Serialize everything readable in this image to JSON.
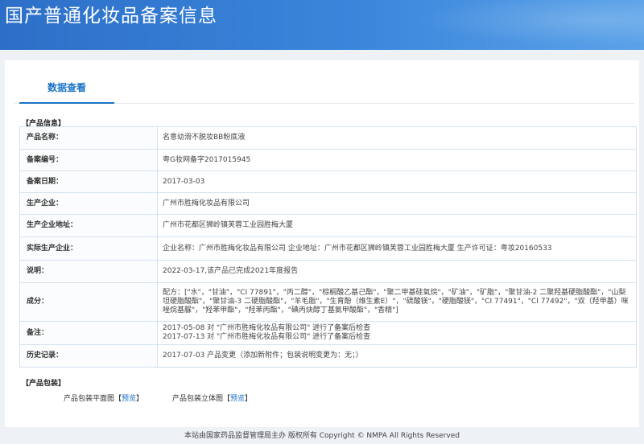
{
  "header": {
    "title": "国产普通化妆品备案信息"
  },
  "tabs": [
    {
      "label": "数据查看"
    }
  ],
  "product_info": {
    "section_title": "【产品信息】",
    "rows": [
      {
        "label": "产品名称：",
        "value": "名意幼滑不脱妆BB粉底液"
      },
      {
        "label": "备案编号：",
        "value": "粤G妆网备字2017015945"
      },
      {
        "label": "备案日期：",
        "value": "2017-03-03"
      },
      {
        "label": "生产企业：",
        "value": "广州市胜梅化妆品有限公司"
      },
      {
        "label": "生产企业地址：",
        "value": "广州市花都区狮岭镇芙蓉工业园胜梅大厦"
      },
      {
        "label": "实际生产企业：",
        "value": "企业名称：广州市胜梅化妆品有限公司 企业地址：广州市花都区狮岭镇芙蓉工业园胜梅大厦 生产许可证：粤妆20160533"
      },
      {
        "label": "说明：",
        "value": "2022-03-17,该产品已完成2021年度报告"
      },
      {
        "label": "成分：",
        "value": "配方：[\"水\"，\"甘油\"，\"CI 77891\"，\"丙二醇\"，\"棕榈酸乙基己酯\"，\"聚二甲基硅氧烷\"，\"矿油\"，\"矿脂\"，\"聚甘油-2 二聚羟基硬脂酸酯\"，\"山梨坦硬脂酸酯\"，\"聚甘油-3 二硬脂酸酯\"，\"羊毛脂\"，\"生育酚（维生素E）\"，\"硫酸镁\"，\"硬脂酸镁\"，\"CI 77491\"，\"CI 77492\"，\"双（羟甲基）咪唑烷基脲\"，\"羟苯甲酯\"，\"羟苯丙酯\"，\"碘丙炔醇丁基氨甲酸酯\"，\"香精\"]"
      },
      {
        "label": "备注：",
        "lines": [
          "2017-05-08 对 \"广州市胜梅化妆品有限公司\" 进行了备案后检查",
          "2017-07-13 对 \"广州市胜梅化妆品有限公司\" 进行了备案后检查"
        ]
      },
      {
        "label": "历史记录：",
        "value": "2017-07-03 产品变更（添加新附件；包装说明变更为：无；）"
      }
    ]
  },
  "packaging": {
    "section_title": "【产品包装】",
    "items": [
      {
        "label": "产品包装平面图",
        "bracket_open": "【",
        "link": "预览",
        "bracket_close": "】"
      },
      {
        "label": "产品包装立体图",
        "bracket_open": "【",
        "link": "预览",
        "bracket_close": "】"
      }
    ]
  },
  "footer": {
    "text": "本站由国家药品监督管理局主办 版权所有 Copyright © NMPA All Rights Reserved"
  }
}
